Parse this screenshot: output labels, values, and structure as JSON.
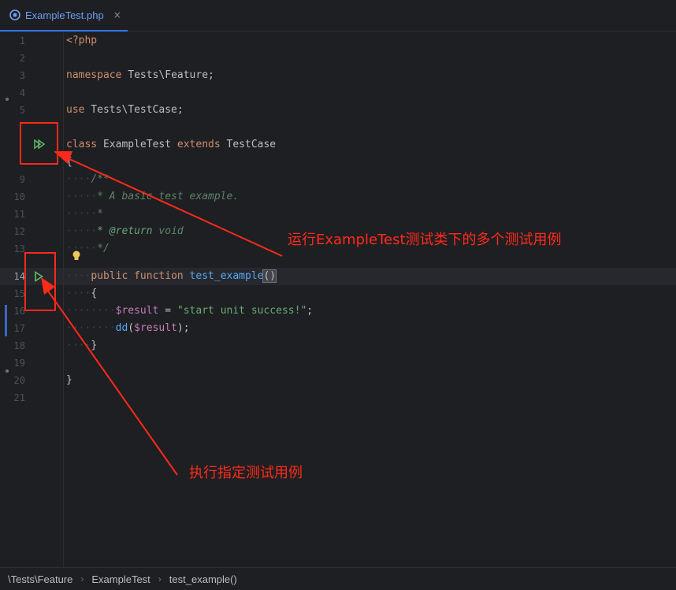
{
  "tab": {
    "title": "ExampleTest.php",
    "close_glyph": "×",
    "icon": "php-file-icon"
  },
  "gutter": {
    "lines": [
      "1",
      "2",
      "3",
      "4",
      "5",
      "",
      "",
      "",
      "9",
      "10",
      "11",
      "12",
      "13",
      "14",
      "15",
      "16",
      "17",
      "18",
      "19",
      "20",
      "21"
    ]
  },
  "code": {
    "l1": "<?php",
    "l3_kw": "namespace",
    "l3_rest": " Tests\\Feature;",
    "l5_kw": "use",
    "l5_rest": " Tests\\TestCase;",
    "l7_kw1": "class",
    "l7_name": " ExampleTest ",
    "l7_kw2": "extends",
    "l7_rest": " TestCase",
    "l8": "{",
    "l9": "/**",
    "l10": "* A basic test example.",
    "l11": "*",
    "l12_tag": "* @return",
    "l12_rest": " void",
    "l13": "*/",
    "l14_kw1": "public",
    "l14_kw2": "function",
    "l14_fn": "test_example",
    "l14_paren": "()",
    "l15": "{",
    "l16_var": "$result",
    "l16_eq": " = ",
    "l16_str": "\"start unit success!\"",
    "l16_semi": ";",
    "l17_fn": "dd",
    "l17_open": "(",
    "l17_var": "$result",
    "l17_close": ");",
    "l18": "}",
    "l20": "}"
  },
  "annotations": {
    "class_run": "运行ExampleTest测试类下的多个测试用例",
    "method_run": "执行指定测试用例"
  },
  "breadcrumb": {
    "items": [
      "\\Tests\\Feature",
      "ExampleTest",
      "test_example()"
    ],
    "separator": "›"
  },
  "colors": {
    "annotation": "#ff2a1a",
    "run_icon": "#5fb865",
    "accent": "#3574f0"
  }
}
